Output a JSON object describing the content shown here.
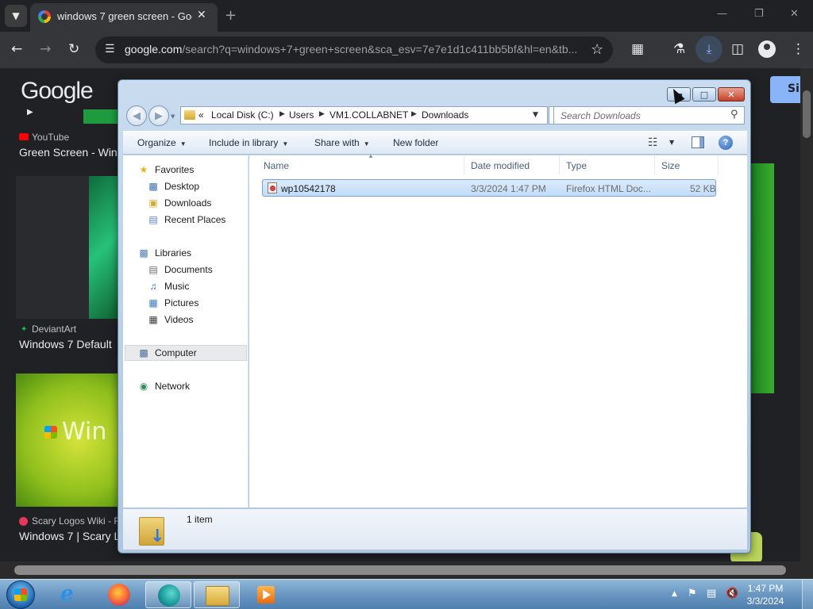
{
  "browser": {
    "tab_title": "windows 7 green screen - Goo",
    "url_host": "google.com",
    "url_path": "/search?q=windows+7+green+screen&sca_esv=7e7e1d1c411bb5bf&hl=en&tb...",
    "icons": {
      "tab_search": "chevron-down-icon",
      "back": "arrow-left-icon",
      "forward": "arrow-right-icon",
      "reload": "reload-icon",
      "bookmark": "star-icon",
      "extensions": "puzzle-icon",
      "labs": "flask-icon",
      "downloads": "download-icon",
      "side_panel": "side-panel-icon",
      "profile": "profile-icon",
      "menu": "three-dot-menu-icon"
    }
  },
  "google_page": {
    "logo": "Google",
    "signin_label": "Si",
    "results": [
      {
        "source": "YouTube",
        "title": "Green Screen - Wind"
      },
      {
        "source": "DeviantArt",
        "title": "Windows 7 Default"
      },
      {
        "source": "Scary Logos Wiki - F",
        "title": "Windows 7 | Scary L"
      }
    ],
    "thumb_text": "Win"
  },
  "explorer": {
    "address": {
      "overflow": "«",
      "segments": [
        "Local Disk (C:)",
        "Users",
        "VM1.COLLABNET",
        "Downloads"
      ]
    },
    "search": {
      "placeholder": "Search Downloads"
    },
    "toolbar": {
      "organize": "Organize",
      "include_in_library": "Include in library",
      "share_with": "Share with",
      "new_folder": "New folder"
    },
    "nav": {
      "favorites": "Favorites",
      "desktop": "Desktop",
      "downloads": "Downloads",
      "recent_places": "Recent Places",
      "libraries": "Libraries",
      "documents": "Documents",
      "music": "Music",
      "pictures": "Pictures",
      "videos": "Videos",
      "computer": "Computer",
      "network": "Network"
    },
    "columns": {
      "name": "Name",
      "date_modified": "Date modified",
      "type": "Type",
      "size": "Size"
    },
    "files": [
      {
        "name": "wp10542178",
        "date_modified": "3/3/2024 1:47 PM",
        "type": "Firefox HTML Doc...",
        "size": "52 KB"
      }
    ],
    "status": {
      "item_count": "1 item"
    }
  },
  "taskbar": {
    "apps": [
      "internet-explorer",
      "firefox",
      "edge",
      "windows-explorer",
      "media-player"
    ],
    "time": "1:47 PM",
    "date": "3/3/2024"
  },
  "colors": {
    "chrome_bg": "#202124",
    "chrome_toolbar": "#35363a",
    "selection_blue": "#c1dcfc",
    "close_red": "#c6412b",
    "taskbar_blue": "#6a97c2"
  }
}
